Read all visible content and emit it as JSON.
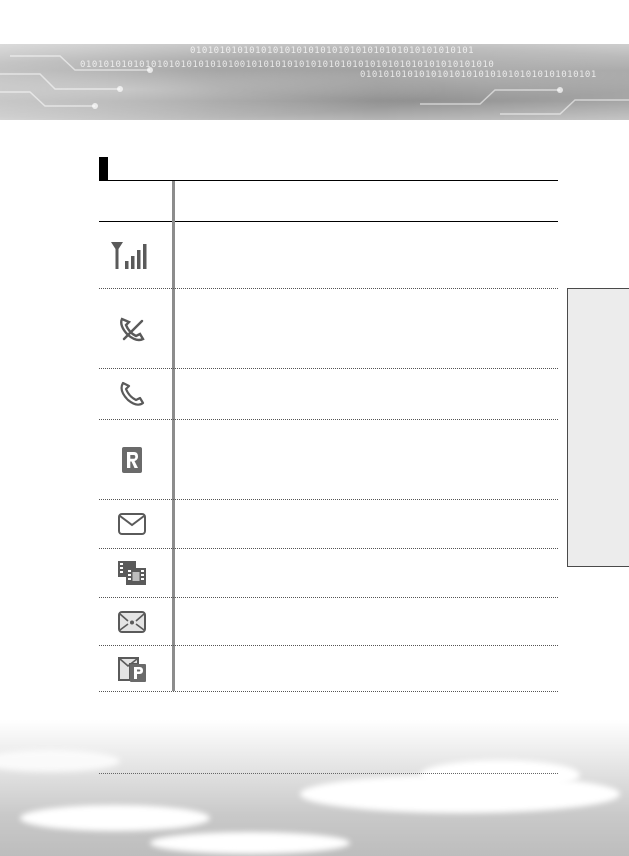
{
  "banner": {
    "binary_line_1": "010101010101010101010101010101010101010101010101",
    "binary_line_2": "0101010101010101010101010100101010101010101010101010101010101010101010",
    "binary_line_3": "0101010101010101010101010101010101010101"
  },
  "table": {
    "header_col1": "",
    "header_col2": "",
    "rows": [
      {
        "icon": "signal-strength-icon",
        "text": ""
      },
      {
        "icon": "no-service-icon",
        "text": ""
      },
      {
        "icon": "call-in-progress-icon",
        "text": ""
      },
      {
        "icon": "roaming-icon",
        "text": ""
      },
      {
        "icon": "new-message-icon",
        "text": ""
      },
      {
        "icon": "new-multimedia-message-icon",
        "text": ""
      },
      {
        "icon": "new-email-icon",
        "text": ""
      },
      {
        "icon": "push-message-icon",
        "text": ""
      }
    ]
  },
  "colors": {
    "rule": "#000000",
    "divider": "#8c8c8c",
    "icon": "#5a5a5a",
    "side_tab": "#ececec"
  }
}
